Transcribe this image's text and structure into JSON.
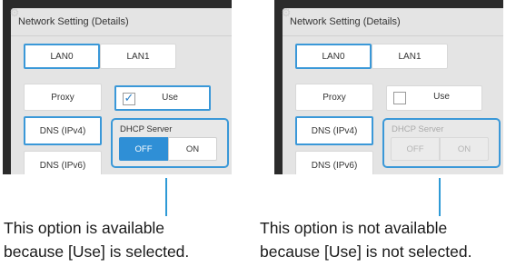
{
  "left": {
    "window_title": "Network Setting (Details)",
    "tabs": [
      "LAN0",
      "LAN1"
    ],
    "side_buttons": [
      "Proxy",
      "DNS (IPv4)",
      "DNS (IPv6)"
    ],
    "use_label": "Use",
    "use_checked": true,
    "dhcp_label": "DHCP Server",
    "off_label": "OFF",
    "on_label": "ON",
    "dhcp_state": "OFF",
    "dhcp_enabled": true,
    "caption_line1": "This option is available",
    "caption_line2": "because [Use] is selected."
  },
  "right": {
    "window_title": "Network Setting (Details)",
    "tabs": [
      "LAN0",
      "LAN1"
    ],
    "side_buttons": [
      "Proxy",
      "DNS (IPv4)",
      "DNS (IPv6)"
    ],
    "use_label": "Use",
    "use_checked": false,
    "dhcp_label": "DHCP Server",
    "off_label": "OFF",
    "on_label": "ON",
    "dhcp_state": null,
    "dhcp_enabled": false,
    "caption_line1": "This option is not available",
    "caption_line2": "because [Use] is not selected."
  },
  "icons": {
    "settings": "gear-icon",
    "check": "checkmark-icon"
  },
  "colors": {
    "accent": "#3a98d8",
    "active_toggle": "#2f8fd6",
    "panel_background": "#e4e4e4",
    "disabled_text": "#aaaaaa"
  }
}
